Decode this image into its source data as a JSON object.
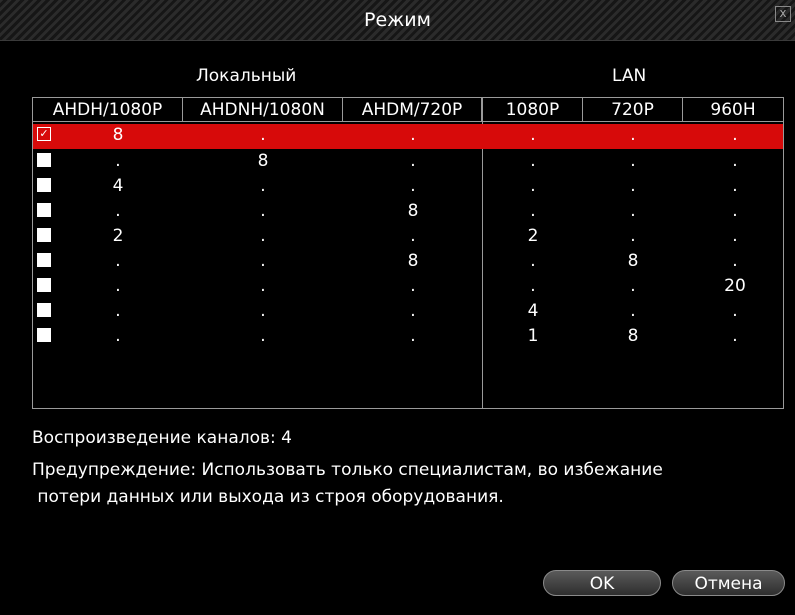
{
  "dialog": {
    "title": "Режим",
    "close_symbol": "x"
  },
  "groups": {
    "local": "Локальный",
    "lan": "LAN"
  },
  "columns": [
    "AHDH/1080P",
    "AHDNH/1080N",
    "AHDM/720P",
    "1080P",
    "720P",
    "960H"
  ],
  "rows": [
    {
      "checked": true,
      "cells": [
        "8",
        ".",
        ".",
        ".",
        ".",
        "."
      ]
    },
    {
      "checked": false,
      "cells": [
        ".",
        "8",
        ".",
        ".",
        ".",
        "."
      ]
    },
    {
      "checked": false,
      "cells": [
        "4",
        ".",
        ".",
        ".",
        ".",
        "."
      ]
    },
    {
      "checked": false,
      "cells": [
        ".",
        ".",
        "8",
        ".",
        ".",
        "."
      ]
    },
    {
      "checked": false,
      "cells": [
        "2",
        ".",
        ".",
        "2",
        ".",
        "."
      ]
    },
    {
      "checked": false,
      "cells": [
        ".",
        ".",
        "8",
        ".",
        "8",
        "."
      ]
    },
    {
      "checked": false,
      "cells": [
        ".",
        ".",
        ".",
        ".",
        ".",
        "20"
      ]
    },
    {
      "checked": false,
      "cells": [
        ".",
        ".",
        ".",
        "4",
        ".",
        "."
      ]
    },
    {
      "checked": false,
      "cells": [
        ".",
        ".",
        ".",
        "1",
        "8",
        "."
      ]
    }
  ],
  "info": {
    "playback": "Воспроизведение каналов: 4",
    "warning_line1": "Предупреждение: Использовать только специалистам, во избежание",
    "warning_line2": " потери данных или выхода из строя оборудования."
  },
  "buttons": {
    "ok": "OK",
    "cancel": "Отмена"
  }
}
